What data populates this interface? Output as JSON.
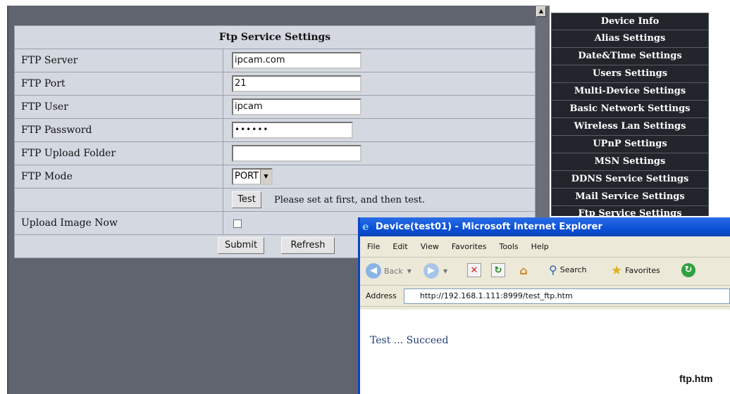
{
  "settings": {
    "title": "Ftp Service Settings",
    "rows": [
      {
        "label": "FTP Server",
        "value": "ipcam.com"
      },
      {
        "label": "FTP Port",
        "value": "21"
      },
      {
        "label": "FTP User",
        "value": "ipcam"
      },
      {
        "label": "FTP Password",
        "value": "••••••"
      },
      {
        "label": "FTP Upload Folder",
        "value": ""
      },
      {
        "label": "FTP Mode",
        "value": "PORT"
      }
    ],
    "test_button": "Test",
    "test_hint": "Please set at first, and then test.",
    "upload_label": "Upload Image Now",
    "upload_checked": false,
    "submit_button": "Submit",
    "refresh_button": "Refresh"
  },
  "menu": {
    "items": [
      "Device Info",
      "Alias Settings",
      "Date&Time Settings",
      "Users Settings",
      "Multi-Device Settings",
      "Basic Network Settings",
      "Wireless Lan Settings",
      "UPnP Settings",
      "MSN Settings",
      "DDNS Service Settings",
      "Mail Service Settings",
      "Ftp Service Settings"
    ]
  },
  "ie": {
    "title": "Device(test01) - Microsoft Internet Explorer",
    "menu": [
      "File",
      "Edit",
      "View",
      "Favorites",
      "Tools",
      "Help"
    ],
    "toolbar": {
      "back": "Back",
      "search": "Search",
      "favorites": "Favorites"
    },
    "address_label": "Address",
    "address_value": "http://192.168.1.111:8999/test_ftp.htm",
    "result": "Test ... Succeed"
  },
  "caption": "ftp.htm",
  "colors": {
    "page_bg": "#60646e",
    "table_bg": "#d4d8e0",
    "menu_bg": "#22252b",
    "ie_title": "#0a4fd6",
    "result_text": "#1f3c7a"
  }
}
